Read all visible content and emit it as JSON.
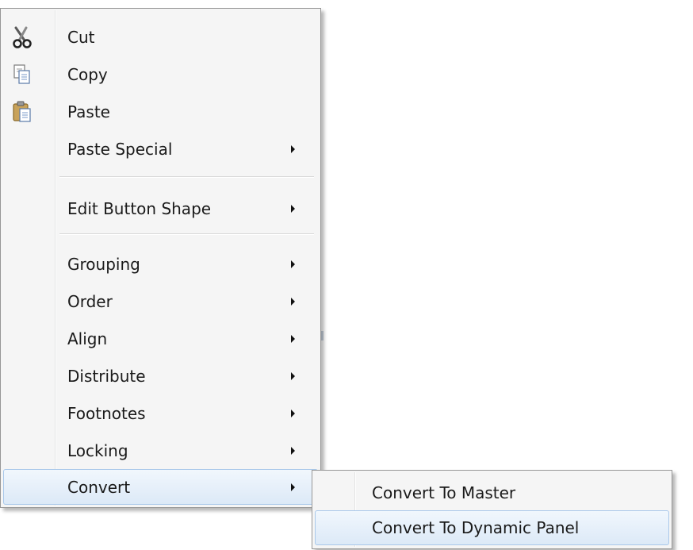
{
  "context_menu": {
    "items": [
      {
        "label": "Cut",
        "icon": "scissors-icon",
        "submenu": false
      },
      {
        "label": "Copy",
        "icon": "copy-icon",
        "submenu": false
      },
      {
        "label": "Paste",
        "icon": "paste-icon",
        "submenu": false
      },
      {
        "label": "Paste Special",
        "icon": null,
        "submenu": true
      },
      {
        "label": "Edit Button Shape",
        "icon": null,
        "submenu": true
      },
      {
        "label": "Grouping",
        "icon": null,
        "submenu": true
      },
      {
        "label": "Order",
        "icon": null,
        "submenu": true
      },
      {
        "label": "Align",
        "icon": null,
        "submenu": true
      },
      {
        "label": "Distribute",
        "icon": null,
        "submenu": true
      },
      {
        "label": "Footnotes",
        "icon": null,
        "submenu": true
      },
      {
        "label": "Locking",
        "icon": null,
        "submenu": true
      },
      {
        "label": "Convert",
        "icon": null,
        "submenu": true,
        "highlighted": true
      }
    ]
  },
  "convert_submenu": {
    "items": [
      {
        "label": "Convert To Master"
      },
      {
        "label": "Convert To Dynamic Panel",
        "highlighted": true
      }
    ]
  },
  "colors": {
    "menu_background": "#f5f5f5",
    "menu_border": "#979797",
    "highlight_top": "#f1f7fd",
    "highlight_bottom": "#dce9f7",
    "highlight_border": "#a9c8ea"
  }
}
